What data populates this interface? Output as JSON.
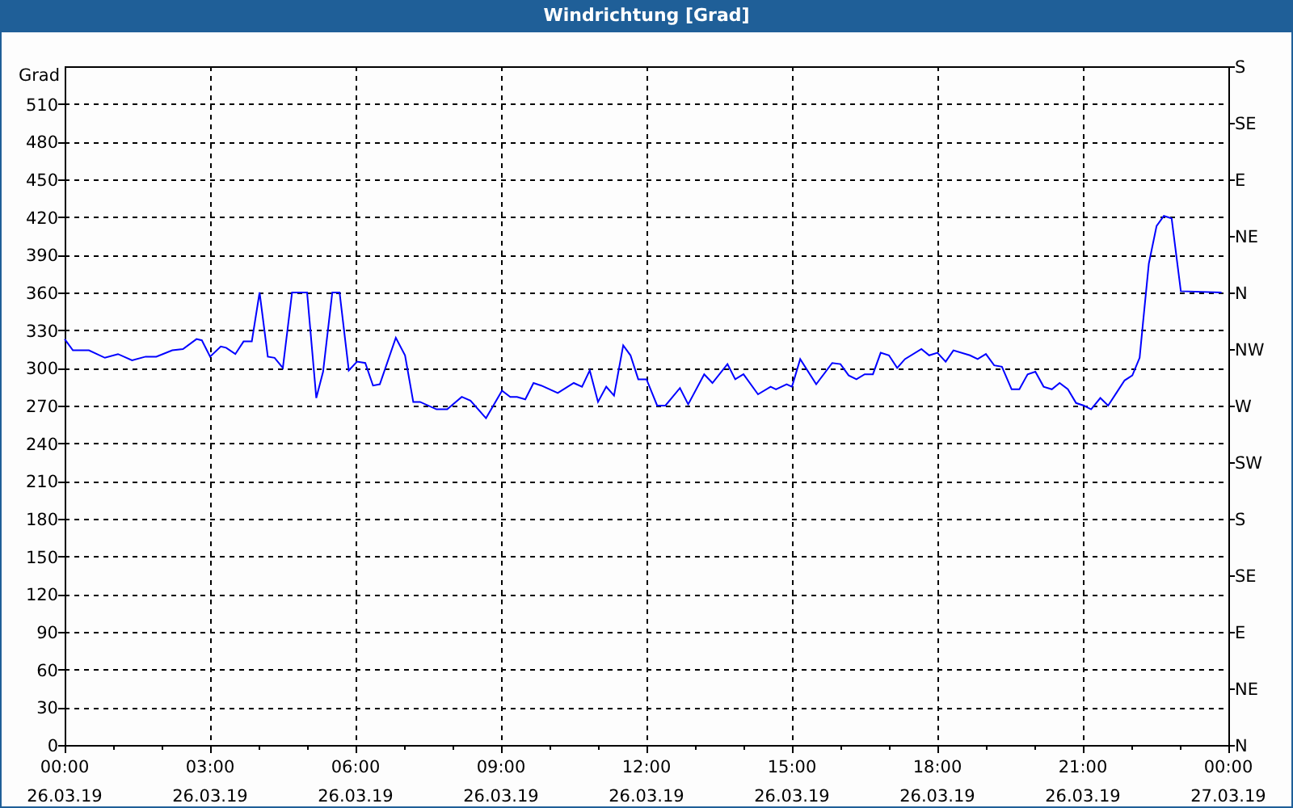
{
  "window": {
    "title": "Windrichtung [Grad]"
  },
  "chart": {
    "chart_data": {
      "type": "line",
      "ylabel": "Grad",
      "x": [
        0,
        0.17,
        0.5,
        0.83,
        1.1,
        1.39,
        1.67,
        1.89,
        2.22,
        2.44,
        2.72,
        2.83,
        3.0,
        3.22,
        3.33,
        3.52,
        3.69,
        3.86,
        4.02,
        4.19,
        4.33,
        4.5,
        4.69,
        5.0,
        5.19,
        5.33,
        5.52,
        5.67,
        5.86,
        6.03,
        6.2,
        6.36,
        6.5,
        6.83,
        7.02,
        7.19,
        7.33,
        7.67,
        7.89,
        8.19,
        8.37,
        8.69,
        9.02,
        9.19,
        9.33,
        9.5,
        9.67,
        9.83,
        10.17,
        10.5,
        10.67,
        10.83,
        11.0,
        11.17,
        11.33,
        11.52,
        11.67,
        11.83,
        12.0,
        12.22,
        12.39,
        12.69,
        12.86,
        13.19,
        13.36,
        13.67,
        13.83,
        14.0,
        14.3,
        14.56,
        14.67,
        14.89,
        15.0,
        15.17,
        15.5,
        15.83,
        16.0,
        16.17,
        16.33,
        16.5,
        16.67,
        16.83,
        17.0,
        17.17,
        17.33,
        17.67,
        17.83,
        18.0,
        18.17,
        18.33,
        18.67,
        18.83,
        19.0,
        19.17,
        19.33,
        19.53,
        19.69,
        19.86,
        20.02,
        20.19,
        20.36,
        20.52,
        20.69,
        20.86,
        21.02,
        21.17,
        21.36,
        21.52,
        21.69,
        21.86,
        22.02,
        22.17,
        22.24,
        22.36,
        22.52,
        22.67,
        22.83,
        23.02,
        23.86
      ],
      "series": [
        {
          "color": "#0000ff",
          "values": [
            323,
            314,
            314,
            308,
            311,
            306,
            309,
            309,
            314,
            315,
            323,
            322,
            309,
            317,
            316,
            311,
            321,
            321,
            360,
            309,
            308,
            300,
            360,
            360,
            276,
            297,
            360,
            360,
            298,
            305,
            304,
            286,
            287,
            324,
            310,
            273,
            273,
            267,
            267,
            277,
            274,
            260,
            282,
            277,
            277,
            275,
            288,
            286,
            280,
            288,
            285,
            298,
            273,
            285,
            278,
            318,
            310,
            291,
            291,
            270,
            270,
            284,
            271,
            295,
            288,
            303,
            291,
            295,
            279,
            285,
            283,
            287,
            285,
            307,
            287,
            304,
            303,
            294,
            291,
            295,
            295,
            312,
            310,
            300,
            307,
            315,
            310,
            312,
            305,
            314,
            310,
            307,
            311,
            302,
            301,
            283,
            283,
            295,
            297,
            285,
            283,
            288,
            283,
            272,
            270,
            267,
            276,
            270,
            280,
            290,
            294,
            308,
            336,
            383,
            413,
            421,
            419,
            361,
            360
          ]
        }
      ],
      "xlim": [
        0,
        24
      ],
      "ylim": [
        0,
        540
      ],
      "grid": true,
      "xticks": [
        {
          "value": 0,
          "label": "00:00"
        },
        {
          "value": 3,
          "label": "03:00"
        },
        {
          "value": 6,
          "label": "06:00"
        },
        {
          "value": 9,
          "label": "09:00"
        },
        {
          "value": 12,
          "label": "12:00"
        },
        {
          "value": 15,
          "label": "15:00"
        },
        {
          "value": 18,
          "label": "18:00"
        },
        {
          "value": 21,
          "label": "21:00"
        },
        {
          "value": 24,
          "label": "00:00"
        }
      ],
      "yticks": [
        0,
        30,
        60,
        90,
        120,
        150,
        180,
        210,
        240,
        270,
        300,
        330,
        360,
        390,
        420,
        450,
        480,
        510
      ]
    },
    "x_tick_dates": [
      "26.03.19",
      "26.03.19",
      "26.03.19",
      "26.03.19",
      "26.03.19",
      "26.03.19",
      "26.03.19",
      "26.03.19",
      "27.03.19"
    ],
    "right_axis_ticks": [
      "S",
      "SE",
      "E",
      "NE",
      "N",
      "NW",
      "W",
      "SW",
      "S",
      "SE",
      "E",
      "NE",
      "N"
    ]
  }
}
